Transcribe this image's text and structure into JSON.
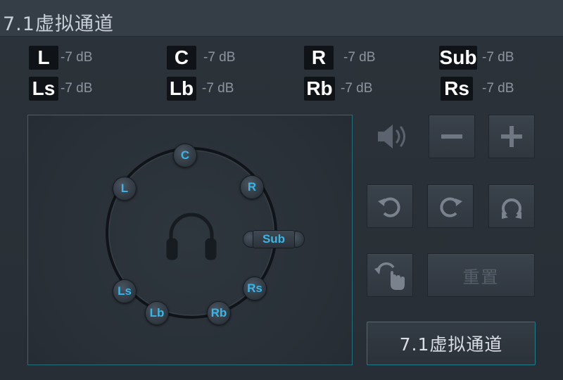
{
  "window": {
    "title": "7.1虚拟通道"
  },
  "levels": [
    {
      "id": "L",
      "label": "L",
      "value": "-7 dB"
    },
    {
      "id": "C",
      "label": "C",
      "value": "-7 dB"
    },
    {
      "id": "R",
      "label": "R",
      "value": "-7 dB"
    },
    {
      "id": "Sub",
      "label": "Sub",
      "value": "-7 dB"
    },
    {
      "id": "Ls",
      "label": "Ls",
      "value": "-7 dB"
    },
    {
      "id": "Lb",
      "label": "Lb",
      "value": "-7 dB"
    },
    {
      "id": "Rb",
      "label": "Rb",
      "value": "-7 dB"
    },
    {
      "id": "Rs",
      "label": "Rs",
      "value": "-7 dB"
    }
  ],
  "speakers": {
    "C": "C",
    "L": "L",
    "R": "R",
    "Sub": "Sub",
    "Ls": "Ls",
    "Lb": "Lb",
    "Rb": "Rb",
    "Rs": "Rs"
  },
  "controls": {
    "reset_label": "重置",
    "virtual_button_label": "7.1虚拟通道"
  },
  "icons": {
    "listener": "headphones-icon",
    "volume": "speaker-volume-icon",
    "minus": "minus-icon",
    "plus": "plus-icon",
    "rotate_ccw": "rotate-left-icon",
    "rotate_cw": "rotate-right-icon",
    "rotate_loop": "rotate-loop-icon",
    "drag": "hand-drag-icon"
  },
  "colors": {
    "speaker_label": "#39b6e8",
    "stage_border": "#1f6f7d",
    "accent_border": "#1f7c8c"
  }
}
